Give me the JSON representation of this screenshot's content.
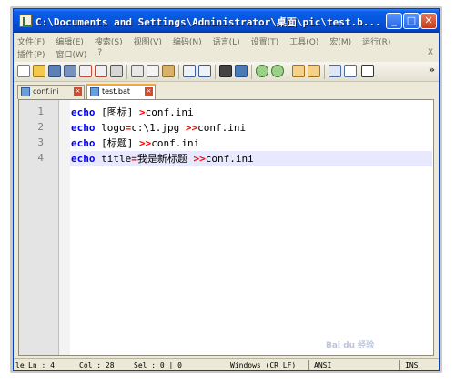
{
  "window": {
    "title": "C:\\Documents and Settings\\Administrator\\桌面\\pic\\test.b...",
    "minimize_label": "_",
    "maximize_label": "□",
    "close_label": "✕"
  },
  "menu": {
    "row1": [
      "文件(F)",
      "编辑(E)",
      "搜索(S)",
      "视图(V)",
      "编码(N)",
      "语言(L)",
      "设置(T)",
      "工具(O)",
      "宏(M)",
      "运行(R)"
    ],
    "row2": [
      "插件(P)",
      "窗口(W)",
      "?"
    ],
    "close_doc": "X"
  },
  "toolbar": {
    "icons": [
      "new-file-icon",
      "open-file-icon",
      "save-icon",
      "save-all-icon",
      "close-icon",
      "close-all-icon",
      "print-icon",
      "cut-icon",
      "copy-icon",
      "paste-icon",
      "undo-icon",
      "redo-icon",
      "find-icon",
      "replace-icon",
      "zoom-in-icon",
      "zoom-out-icon",
      "sync-vertical-icon",
      "sync-horizontal-icon",
      "word-wrap-icon",
      "show-all-chars-icon",
      "indent-guide-icon"
    ],
    "more": "»"
  },
  "tabs": [
    {
      "label": "conf.ini",
      "active": false
    },
    {
      "label": "test.bat",
      "active": true
    }
  ],
  "editor": {
    "line_numbers": [
      "1",
      "2",
      "3",
      "4"
    ],
    "lines": [
      {
        "keyword": "echo",
        "text": " [图标] ",
        "op": ">",
        "rest": "conf.ini"
      },
      {
        "keyword": "echo",
        "text": " logo",
        "op_mid": "=",
        "text2": "c:\\1.jpg ",
        "op": ">>",
        "rest": "conf.ini"
      },
      {
        "keyword": "echo",
        "text": " [标题] ",
        "op": ">>",
        "rest": "conf.ini"
      },
      {
        "keyword": "echo",
        "text": " title",
        "op_mid": "=",
        "text2": "我是新标题 ",
        "op": ">>",
        "rest": "conf.ini"
      }
    ],
    "current_line": 4
  },
  "status": {
    "length": "le",
    "ln": "Ln : 4",
    "col": "Col : 28",
    "sel": "Sel : 0 | 0",
    "eol": "Windows (CR LF)",
    "encoding": "ANSI",
    "mode": "INS"
  },
  "watermark": "Bai du 经验"
}
